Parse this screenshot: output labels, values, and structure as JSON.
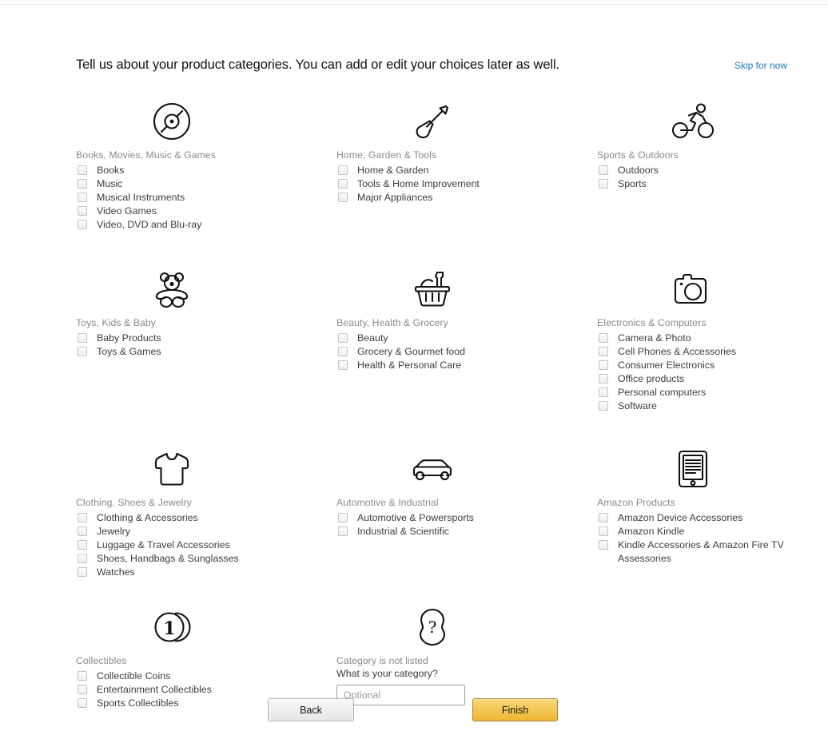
{
  "header": {
    "headline": "Tell us about your product categories. You can add or edit your choices later as well.",
    "skip_label": "Skip for now",
    "skip_color": "#1f7bbf"
  },
  "groups": [
    {
      "icon": "vinyl-record-icon",
      "title": "Books, Movies, Music & Games",
      "items": [
        "Books",
        "Music",
        "Musical Instruments",
        "Video Games",
        "Video, DVD and Blu-ray"
      ]
    },
    {
      "icon": "shovel-icon",
      "title": "Home, Garden & Tools",
      "items": [
        "Home & Garden",
        "Tools & Home Improvement",
        "Major Appliances"
      ]
    },
    {
      "icon": "cyclist-icon",
      "title": "Sports & Outdoors",
      "items": [
        "Outdoors",
        "Sports"
      ]
    },
    {
      "icon": "teddy-bear-icon",
      "title": "Toys, Kids & Baby",
      "items": [
        "Baby Products",
        "Toys & Games"
      ]
    },
    {
      "icon": "shopping-basket-icon",
      "title": "Beauty, Health & Grocery",
      "items": [
        "Beauty",
        "Grocery & Gourmet food",
        "Health & Personal Care"
      ]
    },
    {
      "icon": "camera-icon",
      "title": "Electronics & Computers",
      "items": [
        "Camera & Photo",
        "Cell Phones & Accessories",
        "Consumer Electronics",
        "Office products",
        "Personal computers",
        "Software"
      ]
    },
    {
      "icon": "tshirt-icon",
      "title": "Clothing, Shoes & Jewelry",
      "items": [
        "Clothing & Accessories",
        "Jewelry",
        "Luggage & Travel Accessories",
        "Shoes, Handbags & Sunglasses",
        "Watches"
      ]
    },
    {
      "icon": "car-icon",
      "title": "Automotive & Industrial",
      "items": [
        "Automotive & Powersports",
        "Industrial & Scientific"
      ]
    },
    {
      "icon": "tablet-icon",
      "title": "Amazon Products",
      "items": [
        "Amazon Device Accessories",
        "Amazon Kindle",
        "Kindle Accessories & Amazon Fire TV Assessories"
      ]
    },
    {
      "icon": "coins-icon",
      "title": "Collectibles",
      "items": [
        "Collectible Coins",
        "Entertainment Collectibles",
        "Sports Collectibles"
      ]
    }
  ],
  "not_listed": {
    "icon": "question-mark-icon",
    "title": "Category is not listed",
    "question": "What is your category?",
    "input_value": "",
    "input_placeholder": "Optional"
  },
  "footer": {
    "back_label": "Back",
    "finish_label": "Finish",
    "finish_color": "#eeb632"
  }
}
